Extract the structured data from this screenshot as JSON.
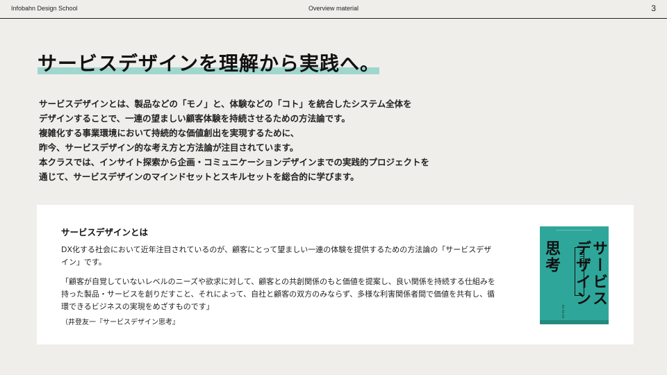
{
  "header": {
    "school": "Infobahn Design School",
    "section": "Overview material",
    "page_number": "3"
  },
  "title": "サービスデザインを理解から実践へ。",
  "intro_lines": [
    "サービスデザインとは、製品などの「モノ」と、体験などの「コト」を統合したシステム全体を",
    "デザインすることで、一連の望ましい顧客体験を持続させるための方法論です。",
    "複雑化する事業環境において持続的な価値創出を実現するために、",
    "昨今、サービスデザイン的な考え方と方法論が注目されています。",
    "本クラスでは、インサイト探索から企画・コミュニケーションデザインまでの実践的プロジェクトを",
    "通じて、サービスデザインのマインドセットとスキルセットを総合的に学びます。"
  ],
  "card": {
    "title": "サービスデザインとは",
    "description": "DX化する社会において近年注目されているのが、顧客にとって望ましい一連の体験を提供するための方法論の「サービスデザイン」です。",
    "quote": "「顧客が自覚していないレベルのニーズや欲求に対して、顧客との共創関係のもと価値を提案し、良い関係を持続する仕組みを持った製品・サービスを創りだすこと、それによって、自社と顧客の双方のみならず、多様な利害関係者間で価値を共有し、循環できるビジネスの実現をめざすものです」",
    "source": "（井登友一『サービスデザイン思考』",
    "book": {
      "main_title": "サービスデザイン",
      "think": "思考",
      "color": "#2ea79a"
    }
  }
}
